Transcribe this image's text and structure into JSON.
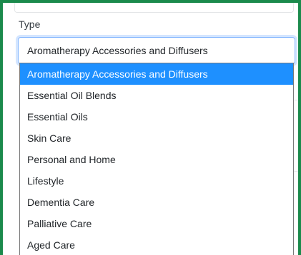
{
  "field": {
    "label": "Type",
    "selected_value": "Aromatherapy Accessories and Diffusers"
  },
  "dropdown": {
    "options": [
      "Aromatherapy Accessories and Diffusers",
      "Essential Oil Blends",
      "Essential Oils",
      "Skin Care",
      "Personal and Home",
      "Lifestyle",
      "Dementia Care",
      "Palliative Care",
      "Aged Care"
    ],
    "highlighted_index": 0
  },
  "colors": {
    "frame_border": "#1b8a4c",
    "highlight": "#1e90ff",
    "focus_border": "#86b7fe"
  }
}
